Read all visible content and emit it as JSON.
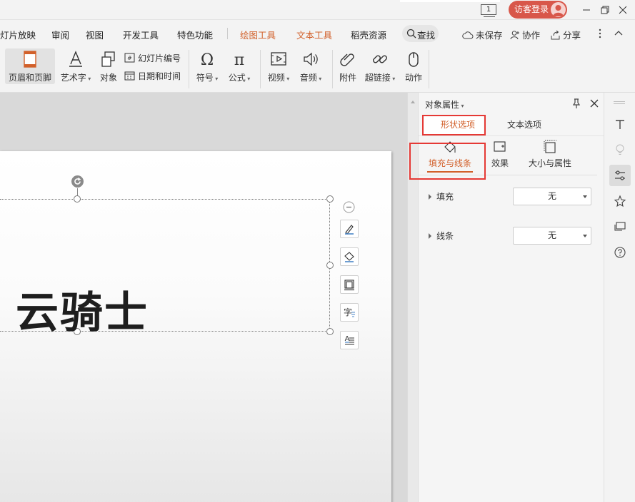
{
  "titlebar": {
    "page_indicator": "1",
    "login_label": "访客登录"
  },
  "menu": {
    "items": [
      "灯片放映",
      "审阅",
      "视图",
      "开发工具",
      "特色功能",
      "绘图工具",
      "文本工具",
      "稻壳资源"
    ],
    "search": "查找",
    "unsaved": "未保存",
    "collab": "协作",
    "share": "分享"
  },
  "ribbon": {
    "header_footer": "页眉和页脚",
    "art_text": "艺术字",
    "object": "对象",
    "slide_number": "幻灯片编号",
    "date_time": "日期和时间",
    "symbol": "符号",
    "formula": "公式",
    "video": "视频",
    "audio": "音频",
    "attachment": "附件",
    "hyperlink": "超链接",
    "action": "动作"
  },
  "slide": {
    "text": "云骑士"
  },
  "panel": {
    "title": "对象属性",
    "tab_shape": "形状选项",
    "tab_text": "文本选项",
    "sub_fill_line": "填充与线条",
    "sub_effect": "效果",
    "sub_size": "大小与属性",
    "fill_label": "填充",
    "fill_value": "无",
    "line_label": "线条",
    "line_value": "无"
  },
  "colors": {
    "accent_orange": "#d2602a",
    "highlight_red": "#e53935",
    "login_red": "#d8574a"
  }
}
